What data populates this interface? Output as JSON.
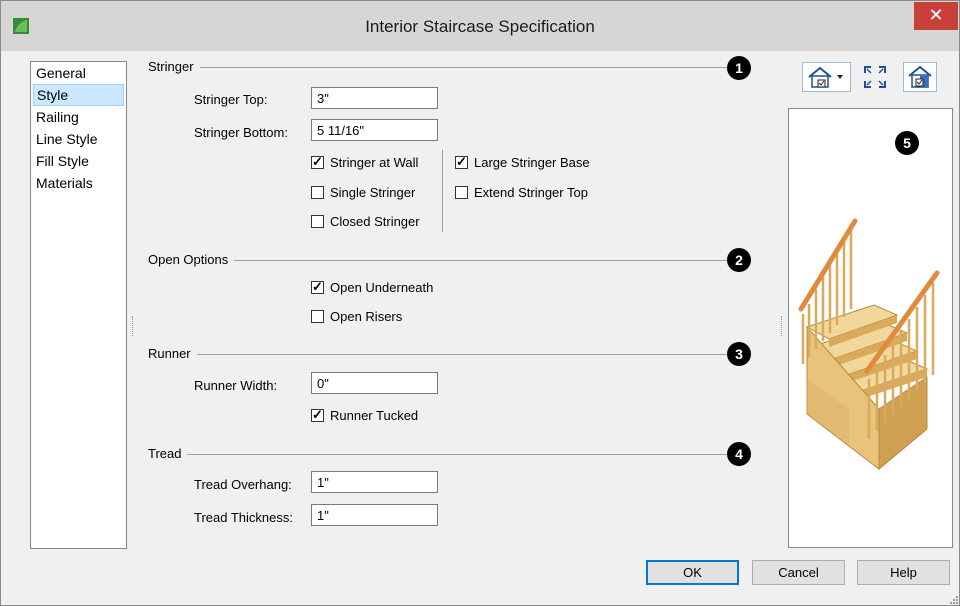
{
  "window": {
    "title": "Interior Staircase Specification",
    "close_label": "✕"
  },
  "nav": {
    "items": [
      "General",
      "Style",
      "Railing",
      "Line Style",
      "Fill Style",
      "Materials"
    ],
    "selected": "Style"
  },
  "stringer": {
    "heading": "Stringer",
    "badge": "1",
    "top_label": "Stringer Top:",
    "top_value": "3\"",
    "bottom_label": "Stringer Bottom:",
    "bottom_value": "5 11/16\"",
    "checks_left": [
      {
        "label": "Stringer at Wall",
        "checked": true
      },
      {
        "label": "Single Stringer",
        "checked": false
      },
      {
        "label": "Closed Stringer",
        "checked": false
      }
    ],
    "checks_right": [
      {
        "label": "Large Stringer Base",
        "checked": true
      },
      {
        "label": "Extend Stringer Top",
        "checked": false
      }
    ]
  },
  "open_options": {
    "heading": "Open Options",
    "badge": "2",
    "checks": [
      {
        "label": "Open Underneath",
        "checked": true
      },
      {
        "label": "Open Risers",
        "checked": false
      }
    ]
  },
  "runner": {
    "heading": "Runner",
    "badge": "3",
    "width_label": "Runner Width:",
    "width_value": "0\"",
    "tucked_label": "Runner Tucked",
    "tucked_checked": true
  },
  "tread": {
    "heading": "Tread",
    "badge": "4",
    "overhang_label": "Tread Overhang:",
    "overhang_value": "1\"",
    "thickness_label": "Tread Thickness:",
    "thickness_value": "1\""
  },
  "preview": {
    "badge": "5",
    "toolbar_icons": [
      "house-view-icon",
      "fit-view-icon",
      "camera-house-icon"
    ]
  },
  "buttons": {
    "ok": "OK",
    "cancel": "Cancel",
    "help": "Help"
  },
  "colors": {
    "title_bar": "#d6d6d6",
    "close": "#c7403a",
    "selection": "#cce8ff",
    "wood": "#e8c37a"
  }
}
